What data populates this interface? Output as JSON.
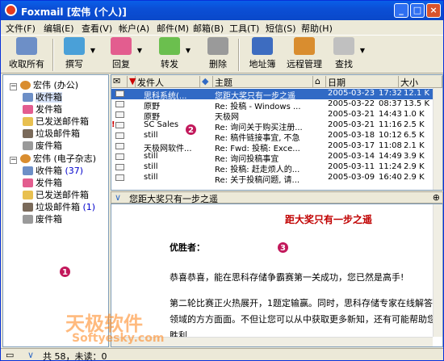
{
  "window": {
    "title": "Foxmail [宏伟 (个人)]",
    "buttons": [
      "_",
      "□",
      "×"
    ]
  },
  "menu": [
    "文件(F)",
    "编辑(E)",
    "查看(V)",
    "帐户(A)",
    "邮件(M)",
    "邮箱(B)",
    "工具(T)",
    "短信(S)",
    "帮助(H)"
  ],
  "toolbar": {
    "receive_all": "收取所有",
    "compose": "撰写",
    "reply": "回复",
    "forward": "转发",
    "delete": "删除",
    "address_book": "地址簿",
    "remote_manage": "远程管理",
    "search": "查找"
  },
  "folders": {
    "account1": "宏伟 (办公)",
    "account1_items": [
      "收件箱",
      "发件箱",
      "已发送邮件箱",
      "垃圾邮件箱",
      "废件箱"
    ],
    "account2": "宏伟 (电子杂志)",
    "account2_items": [
      "收件箱",
      "发件箱",
      "已发送邮件箱",
      "垃圾邮件箱",
      "废件箱"
    ],
    "account2_inbox_count": "(37)",
    "account2_junk_count": "(1)"
  },
  "maillist": {
    "columns": [
      "发件人",
      "主题",
      "日期",
      "大小"
    ],
    "rows": [
      {
        "sender": "思科系统(...",
        "subject": "您距大奖只有一步之遥",
        "date": "2005-03-23",
        "time": "17:32",
        "size": "12.1 K"
      },
      {
        "sender": "原野",
        "subject": "Re: 投稿 - Windows ...",
        "date": "2005-03-22",
        "time": "08:37",
        "size": "13.5 K"
      },
      {
        "sender": "原野",
        "subject": "天极网",
        "date": "2005-03-21",
        "time": "14:43",
        "size": "1.0 K"
      },
      {
        "sender": "SC Sales",
        "subject": "Re: 询问关于购买注册...",
        "date": "2005-03-21",
        "time": "11:16",
        "size": "2.5 K"
      },
      {
        "sender": "still",
        "subject": "Re: 稿件链接事宜, 不急",
        "date": "2005-03-18",
        "time": "10:12",
        "size": "6.5 K"
      },
      {
        "sender": "天极网软件...",
        "subject": "Re: Fwd: 投稿: Exce...",
        "date": "2005-03-17",
        "time": "11:08",
        "size": "2.1 K"
      },
      {
        "sender": "still",
        "subject": "Re: 询问投稿事宜",
        "date": "2005-03-14",
        "time": "14:49",
        "size": "3.9 K"
      },
      {
        "sender": "still",
        "subject": "Re: 投稿: 赶走烦人的...",
        "date": "2005-03-11",
        "time": "11:24",
        "size": "2.9 K"
      },
      {
        "sender": "still",
        "subject": "Re: 关于投稿问题, 请...",
        "date": "2005-03-09",
        "time": "16:40",
        "size": "2.9 K"
      }
    ]
  },
  "preview": {
    "header_subject": "您距大奖只有一步之遥",
    "title": "距大奖只有一步之遥",
    "salutation": "优胜者：",
    "line1": "恭喜恭喜，能在思科存储争霸赛第一关成功，您已然是高手!",
    "line2": "第二轮比赛正火热展开，1题定输赢。同时，思科存储专家在线解答各种",
    "line3": "领域的方方面面。不但让您可以从中获取更多新知，还有可能帮助您赢得",
    "line4": "胜利"
  },
  "status": {
    "text": "共 58，未读：0"
  },
  "markers": [
    "1",
    "2",
    "3"
  ],
  "watermark": {
    "text1": "天极软件",
    "text2": "Softyesky.com"
  },
  "colors": {
    "titlebar": "#0a5fe8",
    "selection": "#316ac5",
    "preview_title": "#c00000",
    "marker": "#c2185b"
  }
}
